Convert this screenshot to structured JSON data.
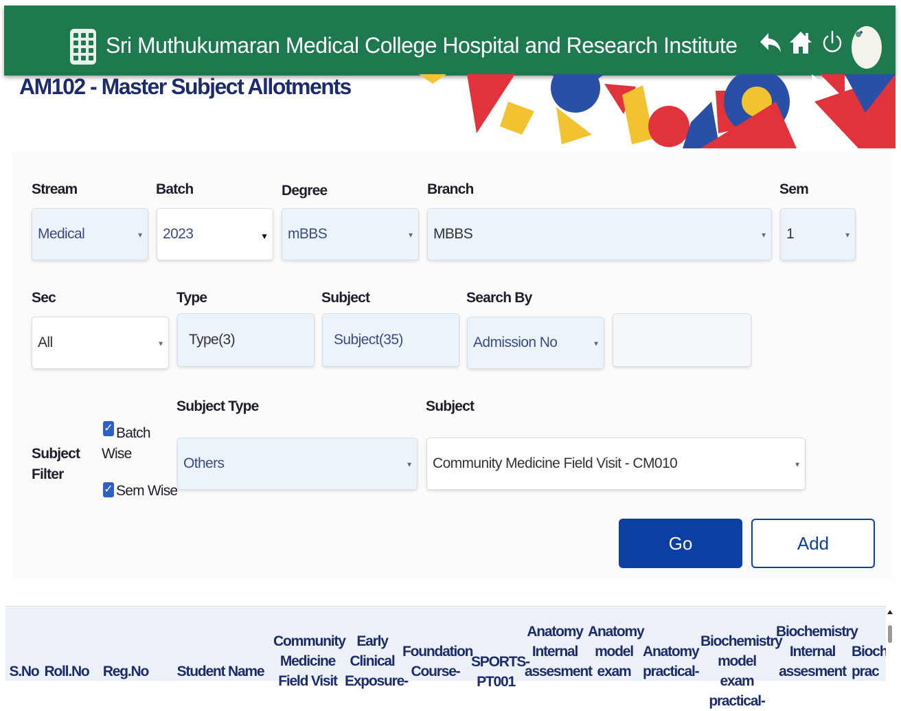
{
  "app": {
    "title": "Sri Muthukumaran Medical College Hospital and Research Institute",
    "header_color": "#1e7a4e",
    "icons": [
      "apps-grid-icon",
      "back-icon",
      "home-icon",
      "power-icon",
      "avatar"
    ]
  },
  "page": {
    "title": "AM102 - Master Subject Allotments"
  },
  "filters": {
    "stream": {
      "label": "Stream",
      "value": "Medical"
    },
    "batch": {
      "label": "Batch",
      "value": "2023"
    },
    "degree": {
      "label": "Degree",
      "value": "mBBS"
    },
    "branch": {
      "label": "Branch",
      "value": "MBBS"
    },
    "sem": {
      "label": "Sem",
      "value": "1"
    },
    "sec": {
      "label": "Sec",
      "value": "All"
    },
    "type": {
      "label": "Type",
      "value": "Type(3)"
    },
    "subject": {
      "label": "Subject",
      "value": "Subject(35)"
    },
    "search_by": {
      "label": "Search By",
      "value": "Admission No"
    },
    "search_text": {
      "value": ""
    }
  },
  "subject_filter": {
    "label": "Subject\nFilter",
    "batch_wise": {
      "label": "Batch\nWise",
      "checked": true
    },
    "sem_wise": {
      "label": "Sem Wise",
      "checked": true
    },
    "subject_type": {
      "label": "Subject Type",
      "value": "Others"
    },
    "subject": {
      "label": "Subject",
      "value": "Community Medicine Field Visit - CM010"
    }
  },
  "actions": {
    "go": "Go",
    "add": "Add",
    "go_color": "#0d3fa3"
  },
  "table": {
    "columns": [
      "S.No",
      "Roll.No",
      "Reg.No",
      "Student Name",
      "Community\nMedicine\nField Visit",
      "Early\nClinical\nExposure-",
      "Foundation\nCourse-",
      "SPORTS-\nPT001",
      "Anatomy\nInternal\nassesment",
      "Anatomy\nmodel\nexam",
      "Anatomy\npractical-",
      "Biochemistry\nmodel exam\npractical-",
      "Biochemistry\nInternal\nassesment",
      "Bioche\nprac"
    ]
  }
}
